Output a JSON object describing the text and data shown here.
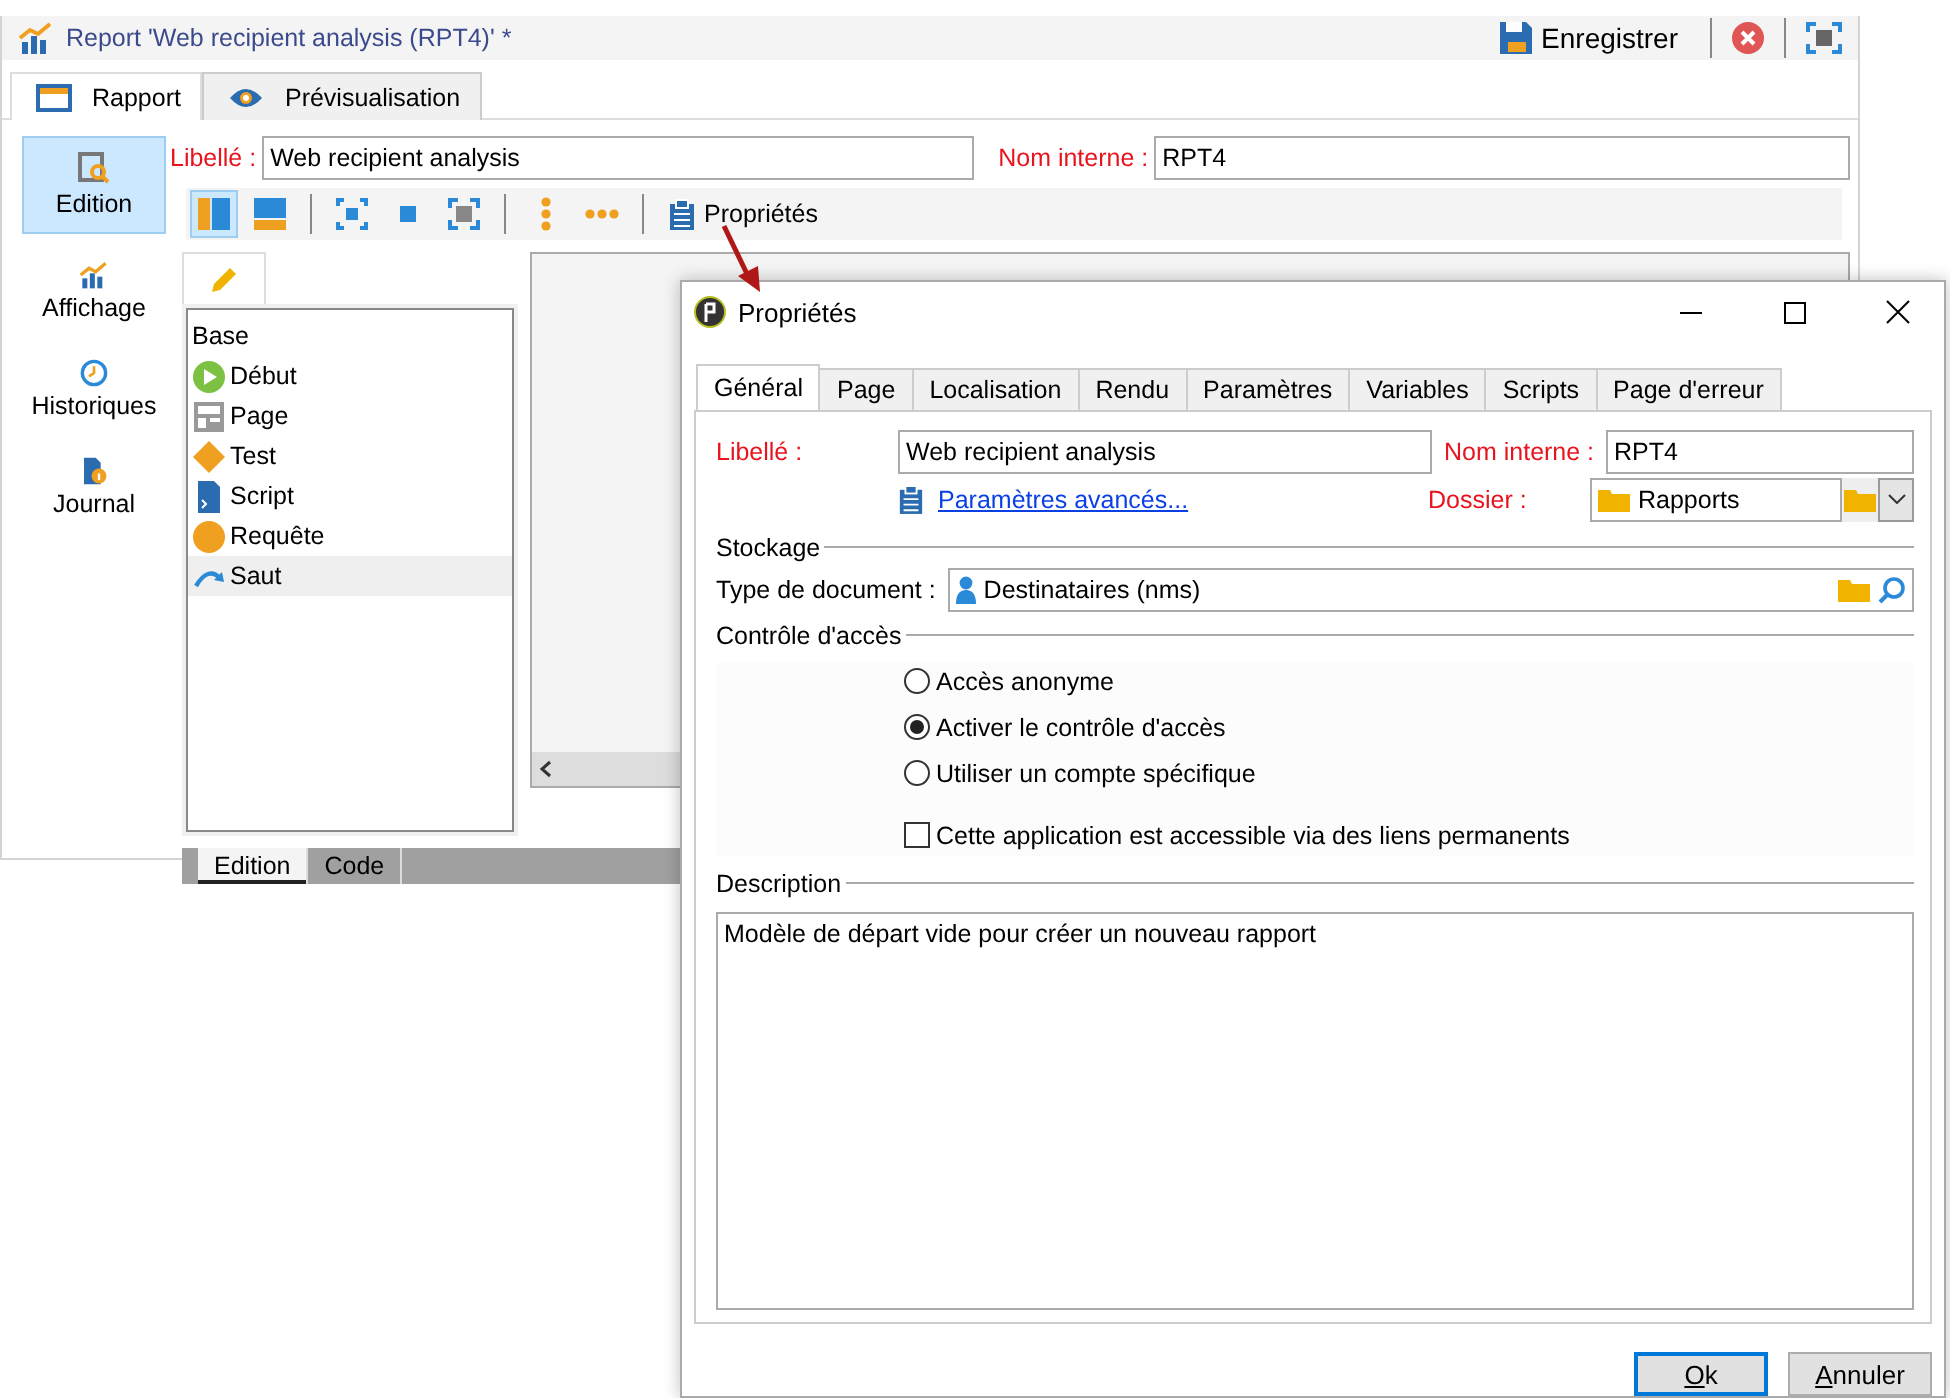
{
  "report_window": {
    "title": "Report 'Web recipient analysis (RPT4)' *",
    "save_button": "Enregistrer",
    "tabs": [
      {
        "label": "Rapport",
        "selected": true
      },
      {
        "label": "Prévisualisation",
        "selected": false
      }
    ],
    "sidebar": [
      {
        "label": "Edition",
        "selected": true
      },
      {
        "label": "Affichage",
        "selected": false
      },
      {
        "label": "Historiques",
        "selected": false
      },
      {
        "label": "Journal",
        "selected": false
      }
    ],
    "label_field": {
      "label": "Libellé :",
      "value": "Web recipient analysis"
    },
    "internal_name_field": {
      "label": "Nom interne :",
      "value": "RPT4"
    },
    "toolbar": {
      "layout_buttons": [
        {
          "selected": true
        },
        {
          "selected": false
        }
      ],
      "properties_button": "Propriétés"
    },
    "palette": {
      "group": "Base",
      "items": [
        {
          "kind": "start",
          "label": "Début",
          "selected": false
        },
        {
          "kind": "page",
          "label": "Page",
          "selected": false
        },
        {
          "kind": "test",
          "label": "Test",
          "selected": false
        },
        {
          "kind": "script",
          "label": "Script",
          "selected": false
        },
        {
          "kind": "query",
          "label": "Requête",
          "selected": false
        },
        {
          "kind": "jump",
          "label": "Saut",
          "selected": true
        }
      ]
    },
    "bottom_tabs": [
      {
        "label": "Edition",
        "selected": true
      },
      {
        "label": "Code",
        "selected": false
      }
    ]
  },
  "properties_dialog": {
    "title": "Propriétés",
    "tabs": [
      {
        "label": "Général",
        "selected": true
      },
      {
        "label": "Page",
        "selected": false
      },
      {
        "label": "Localisation",
        "selected": false
      },
      {
        "label": "Rendu",
        "selected": false
      },
      {
        "label": "Paramètres",
        "selected": false
      },
      {
        "label": "Variables",
        "selected": false
      },
      {
        "label": "Scripts",
        "selected": false
      },
      {
        "label": "Page d'erreur",
        "selected": false
      }
    ],
    "label_field": {
      "label": "Libellé :",
      "value": "Web recipient analysis"
    },
    "internal_name_field": {
      "label": "Nom interne :",
      "value": "RPT4"
    },
    "advanced_link": "Paramètres avancés...",
    "folder_field": {
      "label": "Dossier :",
      "value": "Rapports"
    },
    "storage_section": "Stockage",
    "document_type_field": {
      "label": "Type de document :",
      "value": "Destinataires (nms)"
    },
    "access_section": "Contrôle d'accès",
    "access_options": [
      {
        "label": "Accès anonyme",
        "selected": false
      },
      {
        "label": "Activer le contrôle d'accès",
        "selected": true
      },
      {
        "label": "Utiliser un compte spécifique",
        "selected": false
      }
    ],
    "permalink_checkbox": {
      "label": "Cette application est accessible via des liens permanents",
      "checked": false
    },
    "description_section": "Description",
    "description": "Modèle de départ vide pour créer un nouveau rapport",
    "buttons": [
      {
        "label": "Ok",
        "default": true
      },
      {
        "label": "Annuler",
        "default": false
      }
    ]
  }
}
